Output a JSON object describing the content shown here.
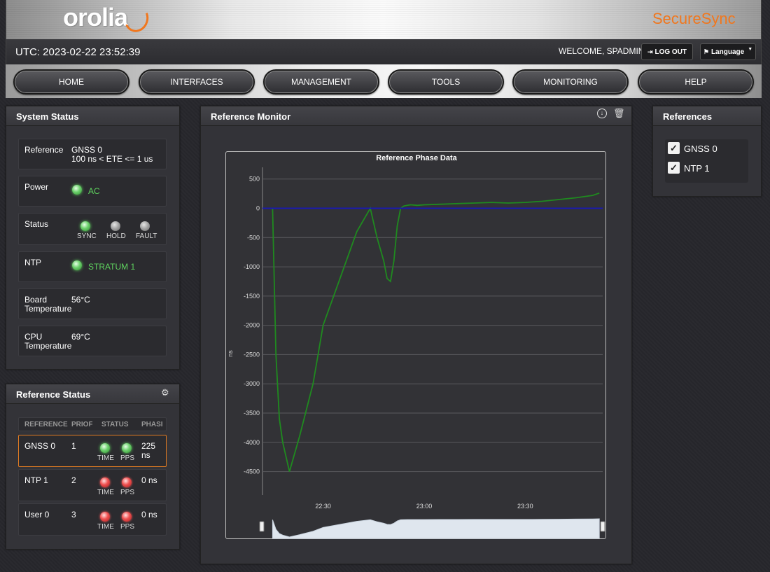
{
  "header": {
    "logo": "orolia",
    "brand": "SecureSync"
  },
  "topbar": {
    "utc": "UTC: 2023-02-22 23:52:39",
    "welcome": "WELCOME, SPADMIN",
    "logout": "LOG OUT",
    "language": "Language"
  },
  "nav": [
    "HOME",
    "INTERFACES",
    "MANAGEMENT",
    "TOOLS",
    "MONITORING",
    "HELP"
  ],
  "system_status": {
    "title": "System Status",
    "reference_label": "Reference",
    "reference_value": "GNSS 0",
    "reference_detail": "100 ns < ETE <= 1 us",
    "power_label": "Power",
    "power_value": "AC",
    "status_label": "Status",
    "status_leds": [
      "SYNC",
      "HOLD",
      "FAULT"
    ],
    "ntp_label": "NTP",
    "ntp_value": "STRATUM 1",
    "board_label_1": "Board",
    "board_label_2": "Temperature",
    "board_value": "56°C",
    "cpu_label_1": "CPU",
    "cpu_label_2": "Temperature",
    "cpu_value": "69°C"
  },
  "reference_status": {
    "title": "Reference Status",
    "columns": [
      "REFERENCE",
      "PRIOF",
      "STATUS",
      "PHASI"
    ],
    "rows": [
      {
        "name": "GNSS 0",
        "priority": "1",
        "time": "TIME",
        "pps": "PPS",
        "phase_1": "225",
        "phase_2": "ns",
        "led": "green"
      },
      {
        "name": "NTP 1",
        "priority": "2",
        "time": "TIME",
        "pps": "PPS",
        "phase_1": "0 ns",
        "phase_2": "",
        "led": "red"
      },
      {
        "name": "User 0",
        "priority": "3",
        "time": "TIME",
        "pps": "PPS",
        "phase_1": "0 ns",
        "phase_2": "",
        "led": "red"
      }
    ]
  },
  "reference_monitor": {
    "title": "Reference Monitor"
  },
  "references": {
    "title": "References",
    "items": [
      "GNSS 0",
      "NTP 1"
    ]
  },
  "colors": {
    "accent": "#f0771e",
    "green_series": "#1f8a1f",
    "blue_series": "#1a1ab0",
    "led_green": "#5fd35f",
    "led_red": "#f05050"
  },
  "chart_data": {
    "type": "line",
    "title": "Reference Phase Data",
    "ylabel": "ns",
    "xlabel": "",
    "ylim": [
      -4900,
      700
    ],
    "yticks": [
      500,
      0,
      -500,
      -1000,
      -1500,
      -2000,
      -2500,
      -3000,
      -3500,
      -4000,
      -4500
    ],
    "xlim": [
      "22:12",
      "23:53"
    ],
    "xticks": [
      "22:30",
      "23:00",
      "23:30"
    ],
    "grid": true,
    "legend": "none",
    "series": [
      {
        "color": "#1f8a1f",
        "x": [
          "22:15",
          "22:16",
          "22:17",
          "22:18",
          "22:20",
          "22:23",
          "22:27",
          "22:30",
          "22:35",
          "22:40",
          "22:44",
          "22:46",
          "22:48",
          "22:49",
          "22:50",
          "22:51",
          "22:52",
          "22:53",
          "22:54",
          "22:55",
          "22:56",
          "22:58",
          "23:00",
          "23:05",
          "23:10",
          "23:15",
          "23:20",
          "23:25",
          "23:30",
          "23:35",
          "23:40",
          "23:45",
          "23:50",
          "23:52"
        ],
        "values": [
          0,
          -2500,
          -3600,
          -4000,
          -4500,
          -3900,
          -3000,
          -2000,
          -1200,
          -400,
          0,
          -500,
          -900,
          -1200,
          -1250,
          -900,
          -300,
          0,
          40,
          50,
          60,
          50,
          60,
          70,
          80,
          90,
          100,
          90,
          100,
          120,
          150,
          180,
          220,
          260
        ]
      },
      {
        "color": "#1a1ab0",
        "x": [
          "22:12",
          "23:53"
        ],
        "values": [
          0,
          0
        ]
      }
    ],
    "navigator": true
  }
}
